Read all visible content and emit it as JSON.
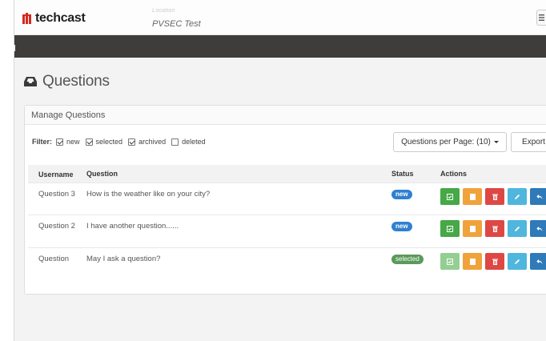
{
  "header": {
    "brand": "techcast",
    "location_label": "Location",
    "location_value": "PVSEC Test",
    "menu_icon": "hamburger-icon"
  },
  "page": {
    "title": "Questions",
    "title_icon": "inbox-tray-icon"
  },
  "panel": {
    "heading": "Manage Questions",
    "filter": {
      "label": "Filter:",
      "options": [
        {
          "label": "new",
          "checked": true
        },
        {
          "label": "selected",
          "checked": true
        },
        {
          "label": "archived",
          "checked": true
        },
        {
          "label": "deleted",
          "checked": false
        }
      ]
    },
    "per_page_button": "Questions per Page: (10)",
    "export_button": "Export"
  },
  "table": {
    "columns": [
      "Username",
      "Question",
      "Status",
      "Actions"
    ],
    "rows": [
      {
        "username": "Question 3",
        "question": "How is the weather like on your city?",
        "status": "new"
      },
      {
        "username": "Question 2",
        "question": "I have another question......",
        "status": "new"
      },
      {
        "username": "Question",
        "question": "May I ask a question?",
        "status": "selected"
      }
    ],
    "action_icons": [
      "check-icon",
      "archive-icon",
      "trash-icon",
      "pencil-icon",
      "reply-icon"
    ]
  },
  "colors": {
    "navbar": "#3f3d3b",
    "badge_new": "#2f80d0",
    "badge_selected": "#5a9a5a",
    "btn_green": "#46a846",
    "btn_orange": "#f0a33a",
    "btn_red": "#de4844",
    "btn_cyan": "#4fb6de",
    "btn_blue": "#2f7ab8"
  }
}
